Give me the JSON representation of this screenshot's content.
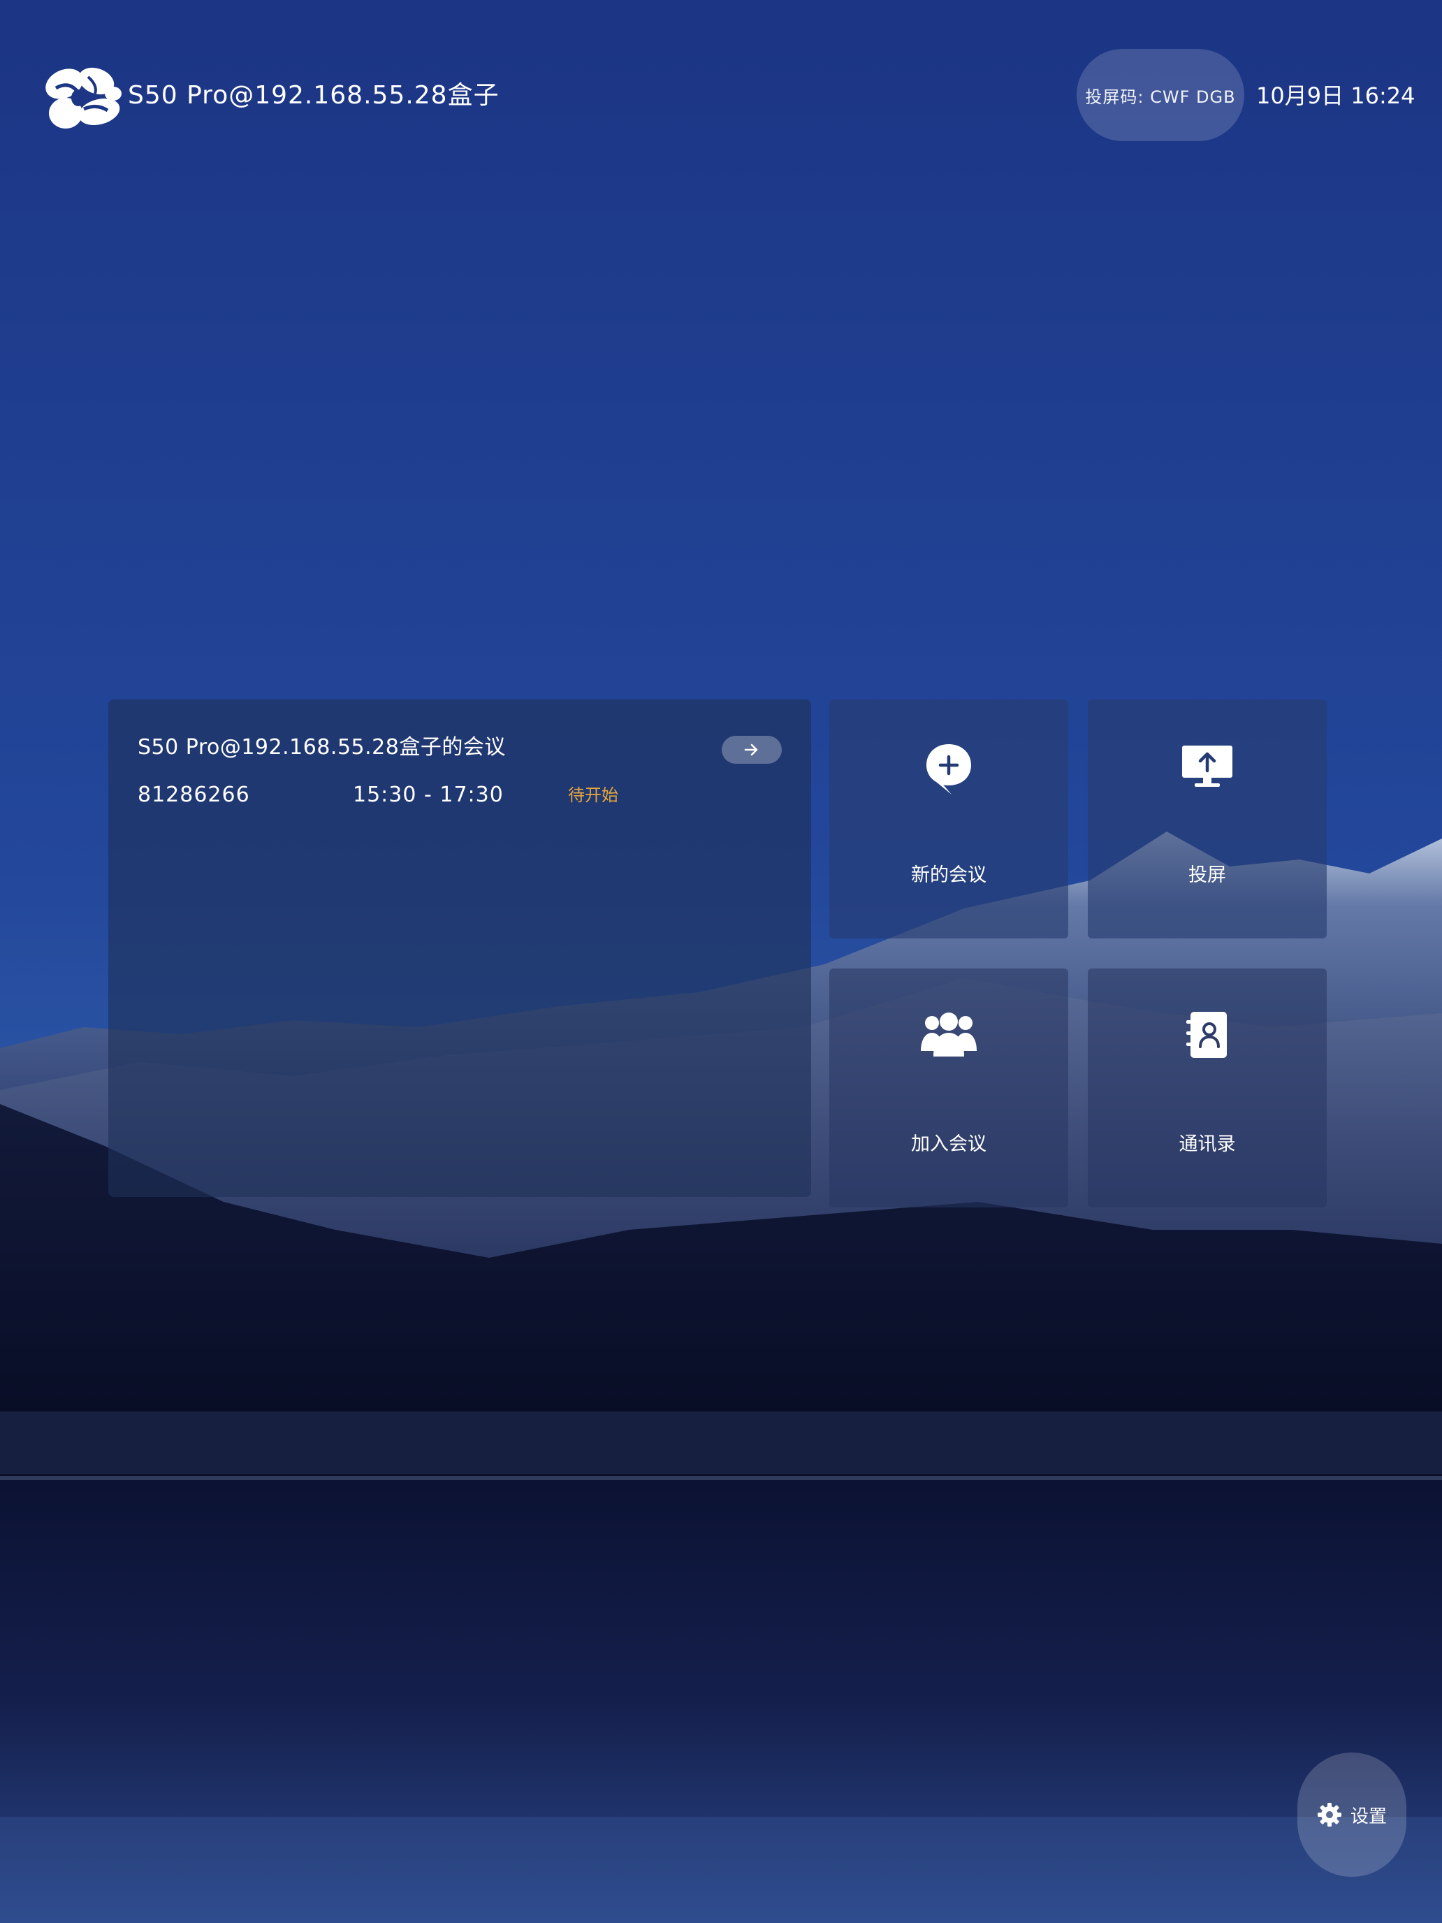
{
  "header": {
    "device_title": "S50 Pro@192.168.55.28盒子",
    "cast_code": "投屏码: CWF DGB",
    "datetime": "10月9日 16:24"
  },
  "meeting": {
    "title": "S50 Pro@192.168.55.28盒子的会议",
    "id": "81286266",
    "time": "15:30 - 17:30",
    "status": "待开始",
    "status_color": "#e8a73a"
  },
  "tiles": [
    {
      "label": "新的会议",
      "icon": "chat-plus-icon"
    },
    {
      "label": "投屏",
      "icon": "screen-share-icon"
    },
    {
      "label": "加入会议",
      "icon": "group-icon"
    },
    {
      "label": "通讯录",
      "icon": "contacts-book-icon"
    }
  ],
  "settings": {
    "label": "设置",
    "icon": "gear-icon"
  }
}
